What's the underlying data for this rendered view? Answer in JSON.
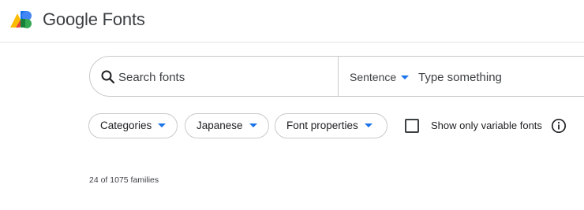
{
  "header": {
    "brand_name": "Google Fonts",
    "logo_icon": "google-fonts-logo"
  },
  "search": {
    "icon": "search-icon",
    "placeholder": "Search fonts",
    "value": "",
    "preview_mode": "Sentence",
    "preview_placeholder": "Type something",
    "preview_value": ""
  },
  "filters": {
    "categories_label": "Categories",
    "language_label": "Japanese",
    "font_properties_label": "Font properties",
    "variable_only_label": "Show only variable fonts",
    "variable_only_checked": false,
    "info_icon": "info-icon"
  },
  "results": {
    "count_text": "24 of 1075 families"
  },
  "colors": {
    "accent": "#1a73e8",
    "text": "#202124",
    "border": "#c9c9c9"
  }
}
